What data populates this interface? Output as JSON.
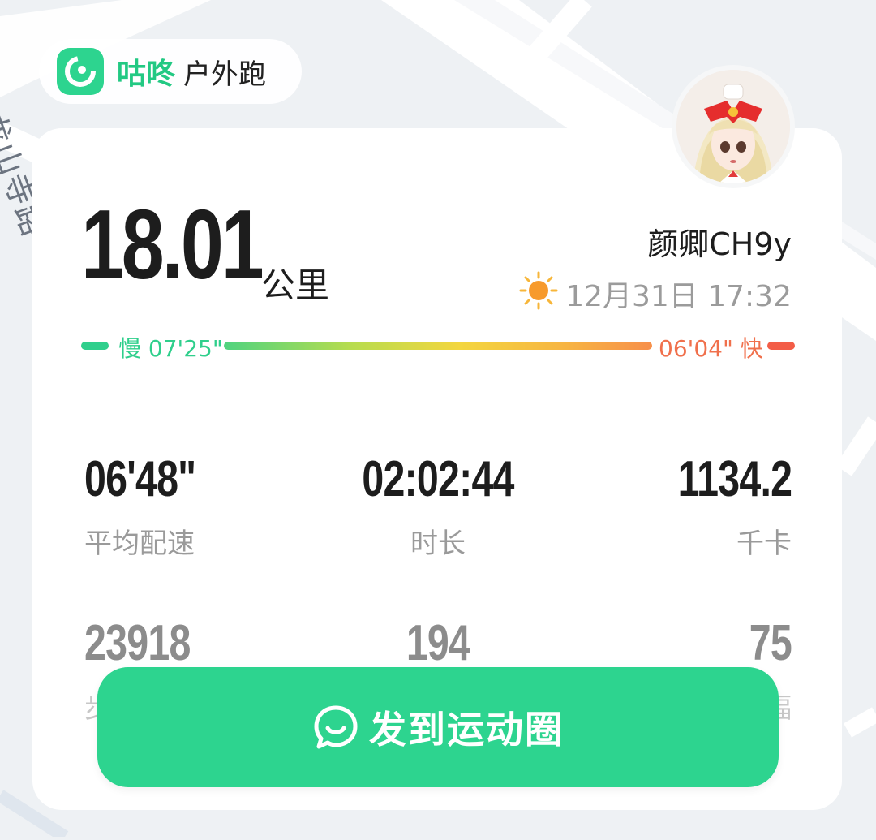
{
  "map": {
    "road_label": "龙山寺路"
  },
  "brand": {
    "name": "咕咚",
    "subtitle": "户外跑"
  },
  "summary": {
    "distance_value": "18.01",
    "distance_unit": "公里",
    "username": "颜卿CH9y",
    "datetime": "12月31日 17:32",
    "weather_icon": "sun-icon"
  },
  "pace": {
    "slow_label": "慢 07'25\"",
    "fast_label": "06'04\" 快",
    "colors": {
      "slow": "#2fcf8c",
      "fast": "#f35d47"
    }
  },
  "stats_row1": [
    {
      "value": "06'48\"",
      "label": "平均配速"
    },
    {
      "value": "02:02:44",
      "label": "时长"
    },
    {
      "value": "1134.2",
      "label": "千卡"
    }
  ],
  "stats_row2": [
    {
      "value": "23918",
      "label_partial": "步"
    },
    {
      "value": "194"
    },
    {
      "value": "75",
      "label_partial": "幅"
    }
  ],
  "cta": {
    "label": "发到运动圈",
    "icon": "chat-smile-icon",
    "color": "#2dd48f"
  }
}
